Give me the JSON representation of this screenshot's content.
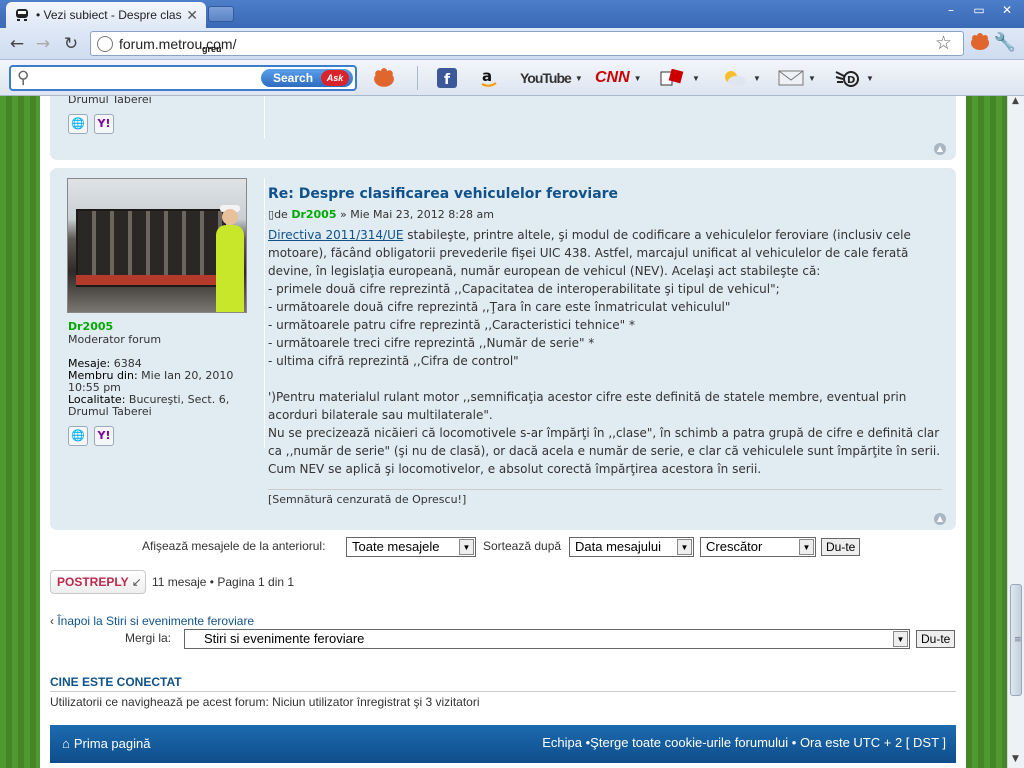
{
  "browser": {
    "tab_title": "• Vezi subiect - Despre clasifica",
    "tab_close": "✕",
    "url": "forum.metrou.com/",
    "url_overlay": "greu",
    "window_buttons": [
      "–",
      "▭",
      "✕"
    ]
  },
  "toolbar": {
    "search_button": "Search",
    "ask_logo": "Ask",
    "items": [
      "facebook-icon",
      "amazon-icon",
      "YouTube",
      "CNN",
      "games-icon",
      "weather-icon",
      "mail-icon",
      "radio-icon"
    ],
    "youtube_label": "YouTube",
    "cnn_label": "CNN"
  },
  "post_prev": {
    "location_tail": "Drumul Taberei"
  },
  "post": {
    "author": "Dr2005",
    "rank": "Moderator forum",
    "posts_label": "Mesaje:",
    "posts_value": "6384",
    "member_label": "Membru din:",
    "member_value": "Mie Ian 20, 2010 10:55 pm",
    "location_label": "Localitate:",
    "location_value": "Bucureşti, Sect. 6, Drumul Taberei",
    "title": "Re: Despre clasificarea vehiculelor feroviare",
    "byline_prefix": "de",
    "byline_date": "» Mie Mai 23, 2012 8:28 am",
    "body_link": "Directiva 2011/314/UE",
    "body_line1_rest": " stabileşte, printre altele, şi modul de codificare a vehiculelor feroviare (inclusiv cele",
    "body_lines": [
      "motoare), făcând obligatorii prevederile fişei UIC 438. Astfel, marcajul unificat al vehiculelor de cale ferată",
      "devine, în legislaţia europeană, număr european de vehicul (NEV). Acelaşi act stabileşte că:",
      "- primele două cifre reprezintă ,,Capacitatea de interoperabilitate şi tipul de vehicul\";",
      "- următoarele două cifre reprezintă ,,Ţara în care este înmatriculat vehiculul\"",
      "- următoarele patru cifre reprezintă ,,Caracteristici tehnice\" *",
      "- următoarele treci cifre reprezintă ,,Număr de serie\" *",
      "- ultima cifră reprezintă ,,Cifra de control\"",
      "",
      "')Pentru materialul rulant motor ,,semnificaţia acestor cifre este definită de statele membre, eventual prin",
      "acorduri bilaterale sau multilaterale\".",
      "Nu se precizează nicăieri că locomotivele s-ar împărţi în ,,clase\", în schimb a patra grupă de cifre e definită clar",
      "ca ,,număr de serie\" (şi nu de clasă), or dacă acela e număr de serie, e clar că vehiculele sunt împărţite în serii.",
      "Cum NEV se aplică şi locomotivelor, e absolut corectă împărţirea acestora în serii."
    ],
    "signature": "[Semnătură cenzurată de Oprescu!]"
  },
  "sortbar": {
    "show_label": "Afişează mesajele de la anteriorul:",
    "show_value": "Toate mesajele",
    "sort_label": "Sortează după",
    "sort_value": "Data mesajului",
    "order_value": "Crescător",
    "go_button": "Du-te"
  },
  "postreply": {
    "label": "POSTREPLY",
    "pagination": "11 mesaje • Pagina 1 din 1"
  },
  "navigation": {
    "back_link": "Înapoi la Stiri si evenimente feroviare",
    "jump_label": "Mergi la:",
    "jump_value": "Stiri si evenimente feroviare",
    "jump_button": "Du-te"
  },
  "online": {
    "title": "CINE ESTE CONECTAT",
    "text": "Utilizatorii ce navighează pe acest forum: Niciun utilizator înregistrat şi 3 vizitatori"
  },
  "footer": {
    "home": "Prima pagină",
    "right": "Echipa •Şterge toate cookie-urile forumului • Ora este UTC + 2 [ DST ]"
  },
  "colors": {
    "link": "#105289",
    "author": "#00aa00",
    "post_bg": "#e1ebf2",
    "footer_bg": "#0f4d8a",
    "page_bg": "#4a8f2a"
  }
}
